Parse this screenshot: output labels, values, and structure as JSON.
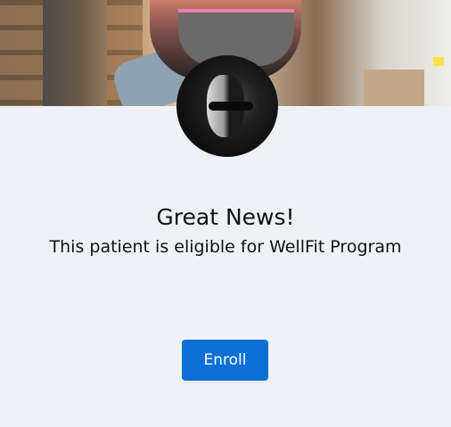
{
  "banner": {
    "image": "gym-workout-photo",
    "avatar": "patient-avatar-photo"
  },
  "message": {
    "title": "Great News!",
    "subtitle": "This patient is eligible for WellFit Program"
  },
  "actions": {
    "enroll_label": "Enroll"
  },
  "colors": {
    "background": "#eef2f8",
    "button": "#0b6fd6",
    "button_text": "#ffffff",
    "text": "#111111"
  }
}
